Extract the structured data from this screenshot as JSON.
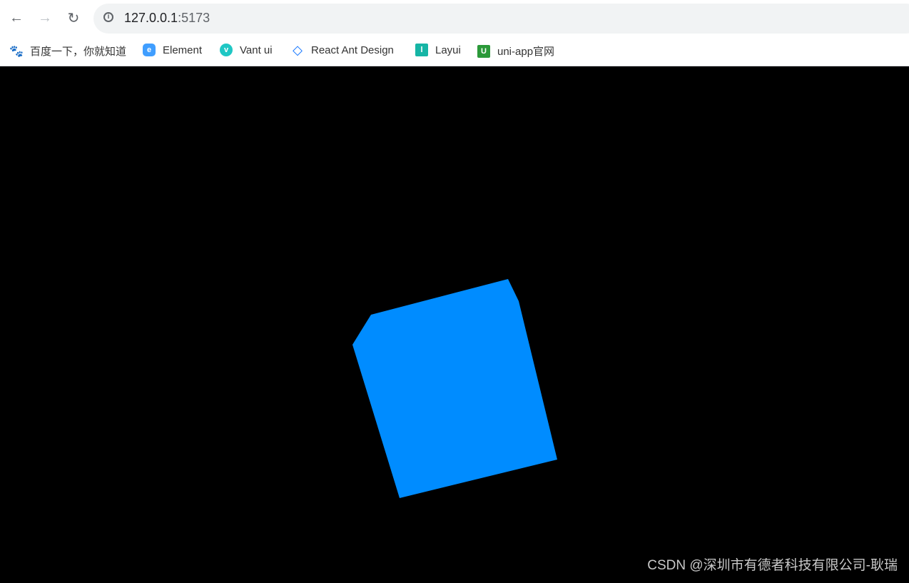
{
  "browser": {
    "url_host": "127.0.0.1",
    "url_port": ":5173",
    "bookmarks": [
      {
        "label": "百度一下，你就知道",
        "icon": "baidu-paw-icon",
        "color": "#2932e1"
      },
      {
        "label": "Element",
        "icon": "element-logo-icon",
        "color": "#409eff"
      },
      {
        "label": "Vant ui",
        "icon": "vant-logo-icon",
        "color": "#1fc7c4"
      },
      {
        "label": "React Ant Design",
        "icon": "antd-logo-icon",
        "color": "#1677ff"
      },
      {
        "label": "Layui",
        "icon": "layui-logo-icon",
        "color": "#16b5a5"
      },
      {
        "label": "uni-app官网",
        "icon": "uniapp-logo-icon",
        "color": "#2b9939"
      }
    ]
  },
  "scene": {
    "background": "#000000",
    "cube_color": "#008cff"
  },
  "watermark": "CSDN @深圳市有德者科技有限公司-耿瑞"
}
